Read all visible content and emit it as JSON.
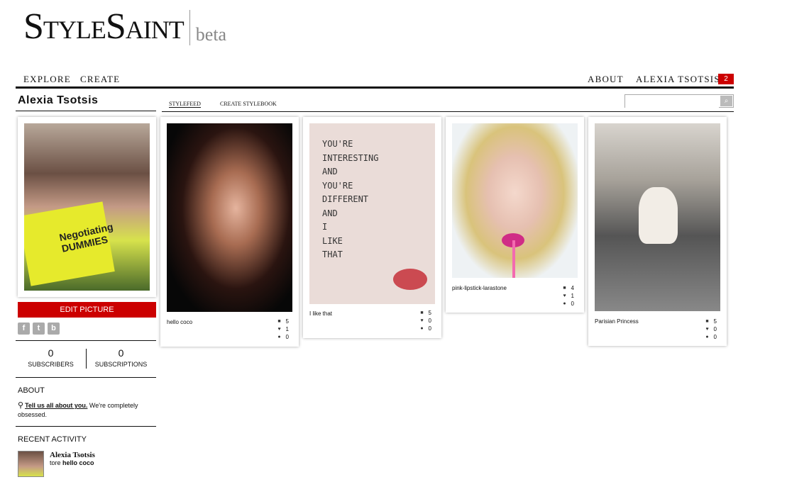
{
  "logo": {
    "main": "StyleSaint",
    "beta": "beta"
  },
  "nav": {
    "explore": "EXPLORE",
    "create": "CREATE",
    "about": "ABOUT",
    "user": "ALEXIA TSOTSIS",
    "badge": "2"
  },
  "profile": {
    "name": "Alexia Tsotsis",
    "avatar_book_text": "Negotiating DUMMIES",
    "edit_picture": "EDIT PICTURE",
    "social": [
      "f",
      "t",
      "b"
    ],
    "subscribers": {
      "count": "0",
      "label": "SUBSCRIBERS"
    },
    "subscriptions": {
      "count": "0",
      "label": "SUBSCRIPTIONS"
    },
    "about_title": "ABOUT",
    "about_link": "Tell us all about you.",
    "about_rest": " We're completely obsessed.",
    "activity_title": "RECENT ACTIVITY",
    "activity_name": "Alexia Tsotsis",
    "activity_verb": "tore ",
    "activity_item": "hello coco"
  },
  "tabs": {
    "stylefeed": "STYLEFEED",
    "create_stylebook": "CREATE STYLEBOOK"
  },
  "search": {
    "placeholder": "",
    "button": "⌕"
  },
  "cards": [
    {
      "caption": "hello coco",
      "tears": "5",
      "likes": "1",
      "comments": "0"
    },
    {
      "caption": "I like that",
      "tears": "5",
      "likes": "0",
      "comments": "0",
      "handwriting": [
        "You're",
        "interesting",
        "and",
        "you're",
        "different",
        "and",
        "I",
        "like",
        "that"
      ]
    },
    {
      "caption": "pink-lipstick-larastone",
      "tears": "4",
      "likes": "1",
      "comments": "0"
    },
    {
      "caption": "Parisian Princess",
      "tears": "5",
      "likes": "0",
      "comments": "0"
    }
  ],
  "icons": {
    "tear": "tear-icon",
    "like": "heart-icon",
    "comment": "comment-icon"
  },
  "colors": {
    "accent": "#cc0000"
  }
}
